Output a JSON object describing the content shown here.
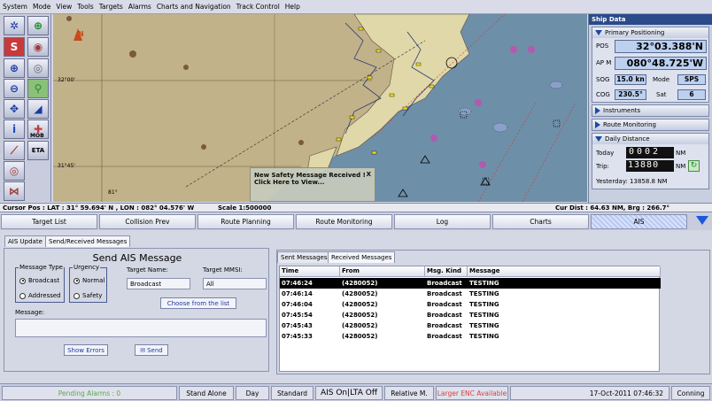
{
  "menu": [
    "System",
    "Mode",
    "View",
    "Tools",
    "Targets",
    "Alarms",
    "Charts and Navigation",
    "Track Control",
    "Help"
  ],
  "chart": {
    "lat_label_1": "32°00'",
    "lat_label_2": "31°45'",
    "lon_label": "81°",
    "north_marker": "N",
    "safety_popup_line1": "New Safety Message Received !",
    "safety_popup_line2": "Click Here to View...",
    "popup_close": "X"
  },
  "ship_data": {
    "title": "Ship Data",
    "primary_positioning": "Primary Positioning",
    "pos_label": "POS",
    "pos_value": "32°03.388'N",
    "apm_label": "AP M",
    "apm_value": "080°48.725'W",
    "sog_label": "SOG",
    "sog_value": "15.0 kn",
    "mode_label": "Mode",
    "mode_value": "SPS",
    "cog_label": "COG",
    "cog_value": "230.5°",
    "sat_label": "Sat",
    "sat_value": "6",
    "instruments": "Instruments",
    "route_monitoring": "Route Monitoring",
    "daily_distance": "Daily Distance",
    "today_label": "Today",
    "today_digits": "0002",
    "trip_label": "Trip:",
    "trip_digits": "13880",
    "nm": "NM",
    "yesterday": "Yesterday: 13858.8 NM"
  },
  "statusline": {
    "cursor": "Cursor Pos : LAT : 31° 59.694' N , LON : 082° 04.576' W",
    "scale": "Scale 1:500000",
    "curdist": "Cur Dist : 64.63 NM, Brg : 266.7°"
  },
  "main_tabs": [
    "Target List",
    "Collision Prev",
    "Route Planning",
    "Route Monitoring",
    "Log",
    "Charts",
    "AIS"
  ],
  "sub_tabs": [
    "AIS Update",
    "Send/Received Messages"
  ],
  "send": {
    "title": "Send AIS Message",
    "message_type": "Message Type",
    "broadcast": "Broadcast",
    "addressed": "Addressed",
    "urgency": "Urgency",
    "normal": "Normal",
    "safety": "Safety",
    "target_name_label": "Target Name:",
    "target_name_value": "Broadcast",
    "target_mmsi_label": "Target MMSI:",
    "target_mmsi_value": "All",
    "choose_btn": "Choose from the list",
    "message_label": "Message:",
    "message_value": "",
    "show_errors": "Show Errors",
    "send_btn": "Send"
  },
  "messages": {
    "tabs": [
      "Sent Messages",
      "Received Messages"
    ],
    "columns": [
      "Time",
      "From",
      "Msg. Kind",
      "Message"
    ],
    "rows": [
      [
        "07:46:24",
        "(4280052)",
        "Broadcast",
        "TESTING"
      ],
      [
        "07:46:14",
        "(4280052)",
        "Broadcast",
        "TESTING"
      ],
      [
        "07:46:04",
        "(4280052)",
        "Broadcast",
        "TESTING"
      ],
      [
        "07:45:54",
        "(4280052)",
        "Broadcast",
        "TESTING"
      ],
      [
        "07:45:43",
        "(4280052)",
        "Broadcast",
        "TESTING"
      ],
      [
        "07:45:33",
        "(4280052)",
        "Broadcast",
        "TESTING"
      ]
    ]
  },
  "bottombar": {
    "pending": "Pending Alarms : 0",
    "standalone": "Stand Alone",
    "day": "Day",
    "standard": "Standard",
    "ais": "AIS On|LTA Off",
    "relative": "Relative M.",
    "enc": "Larger ENC Available",
    "datetime": "17-Oct-2011  07:46:32",
    "conning": "Conning"
  },
  "colors": {
    "land": "#c2b28a",
    "sea": "#6e8fa8",
    "panel_header": "#2a4a8a",
    "value_box": "#bcd0f0",
    "pending_text": "#5aa84a",
    "enc_text": "#d84040"
  }
}
